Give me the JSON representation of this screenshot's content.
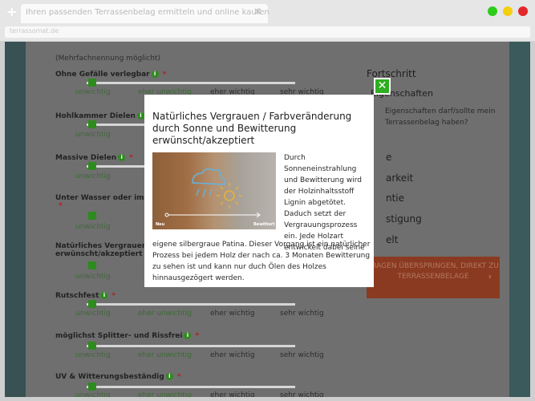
{
  "browser": {
    "tab_title": "Ihren passenden Terrassenbelag ermitteln und online kaufen",
    "tab_close": "✕",
    "new_tab": "+",
    "address": "terrassomat.de",
    "dots": [
      "#2ecc1a",
      "#f4cf0f",
      "#e2262a"
    ]
  },
  "page": {
    "subtitle": "(Mehrfachnennung möglicht)",
    "scale_labels": [
      "unwichtig",
      "eher unwichtig",
      "eher wichtig",
      "sehr wichtig"
    ],
    "questions": [
      {
        "title": "Ohne Gefälle verlegbar"
      },
      {
        "title": "Hohlkammer Dielen"
      },
      {
        "title": "Massive Dielen"
      },
      {
        "title": "Unter Wasser oder im Erd"
      },
      {
        "title": "Natürliches Vergrauen / F",
        "title2": "erwünscht/akzeptiert"
      },
      {
        "title": "Rutschfest"
      },
      {
        "title": "möglichst Splitter- und Rissfrei"
      },
      {
        "title": "UV & Witterungsbeständig"
      }
    ],
    "right": {
      "heading": "Fortschritt",
      "sub": "Eigenschaften",
      "desc": "Eigenschaften darf/sollte mein Terrassenbelag haben?",
      "items": [
        "e",
        "arkeit",
        "ntie",
        "stigung",
        "elt"
      ],
      "cta": "FRAGEN ÜBERSPRINGEN, DIREKT ZU TERRASSENBELAGE",
      "cta_chevron": "›"
    }
  },
  "modal": {
    "close": "✕",
    "title": "Natürliches Vergrauen / Farbveränderung durch Sonne und Bewitterung erwünscht/akzeptiert",
    "image": {
      "left_tag": "Neu",
      "right_tag": "Bewittert"
    },
    "text_right": "Durch Sonneneinstrahlung und Bewitterung wird der Holzinhaltsstoff Lignin abgetötet. Daduch setzt der Vergrauungsprozess ein. Jede Holzart entwickelt dabei seine",
    "text_bottom": "eigene silbergraue Patina. Dieser Vorgang ist ein natürlicher Prozess bei jedem Holz der nach ca. 3 Monaten Bewitterung zu sehen ist und kann nur duch Ölen des Holzes hinnausgezögert werden."
  }
}
